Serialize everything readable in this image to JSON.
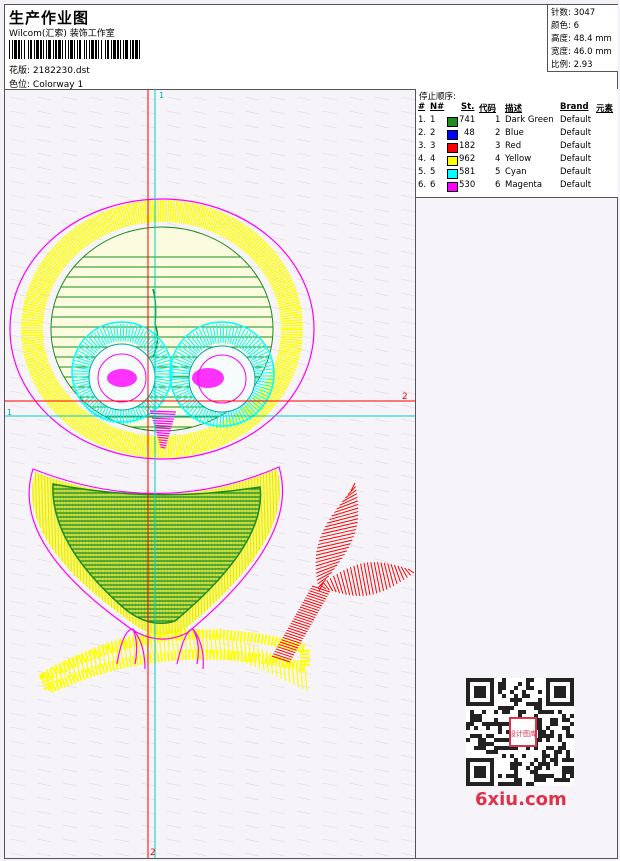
{
  "header": {
    "title": "生产作业图",
    "company": "Wilcom(汇索) 装饰工作室",
    "pattern_label": "花版:",
    "pattern_value": "2182230.dst",
    "colorway_label": "色位:",
    "colorway_value": "Colorway 1"
  },
  "stats": {
    "stitches_label": "针数:",
    "stitches_value": "3047",
    "colors_label": "颜色:",
    "colors_value": "6",
    "height_label": "高度:",
    "height_value": "48.4 mm",
    "width_label": "宽度:",
    "width_value": "46.0 mm",
    "scale_label": "比例:",
    "scale_value": "2.93"
  },
  "sequence": {
    "title": "停止顺序:",
    "headers": {
      "seq": "#",
      "no": "N#",
      "st": "St.",
      "code": "代码",
      "desc": "描述",
      "brand": "Brand",
      "element": "元素"
    },
    "rows": [
      {
        "seq": "1.",
        "no": "1",
        "st": "741",
        "code": "1",
        "desc": "Dark Green",
        "brand": "Default",
        "color": "#1e8c1e"
      },
      {
        "seq": "2.",
        "no": "2",
        "st": "48",
        "code": "2",
        "desc": "Blue",
        "brand": "Default",
        "color": "#0000ff"
      },
      {
        "seq": "3.",
        "no": "3",
        "st": "182",
        "code": "3",
        "desc": "Red",
        "brand": "Default",
        "color": "#ff0000"
      },
      {
        "seq": "4.",
        "no": "4",
        "st": "962",
        "code": "4",
        "desc": "Yellow",
        "brand": "Default",
        "color": "#ffff00"
      },
      {
        "seq": "5.",
        "no": "5",
        "st": "581",
        "code": "5",
        "desc": "Cyan",
        "brand": "Default",
        "color": "#00ffff"
      },
      {
        "seq": "6.",
        "no": "6",
        "st": "530",
        "code": "6",
        "desc": "Magenta",
        "brand": "Default",
        "color": "#ff00ff"
      }
    ]
  },
  "axes": {
    "v_top": "1",
    "h_right": "2",
    "h_left": "1",
    "v_bottom": "2"
  },
  "watermark": {
    "text": "6xiu.com",
    "stamp": "设计图库"
  },
  "colors": {
    "green": "#1e8c1e",
    "yellow": "#ffff00",
    "cyan": "#00ffff",
    "magenta": "#ff00ff",
    "red": "#ff0000",
    "blue": "#0000ff"
  }
}
